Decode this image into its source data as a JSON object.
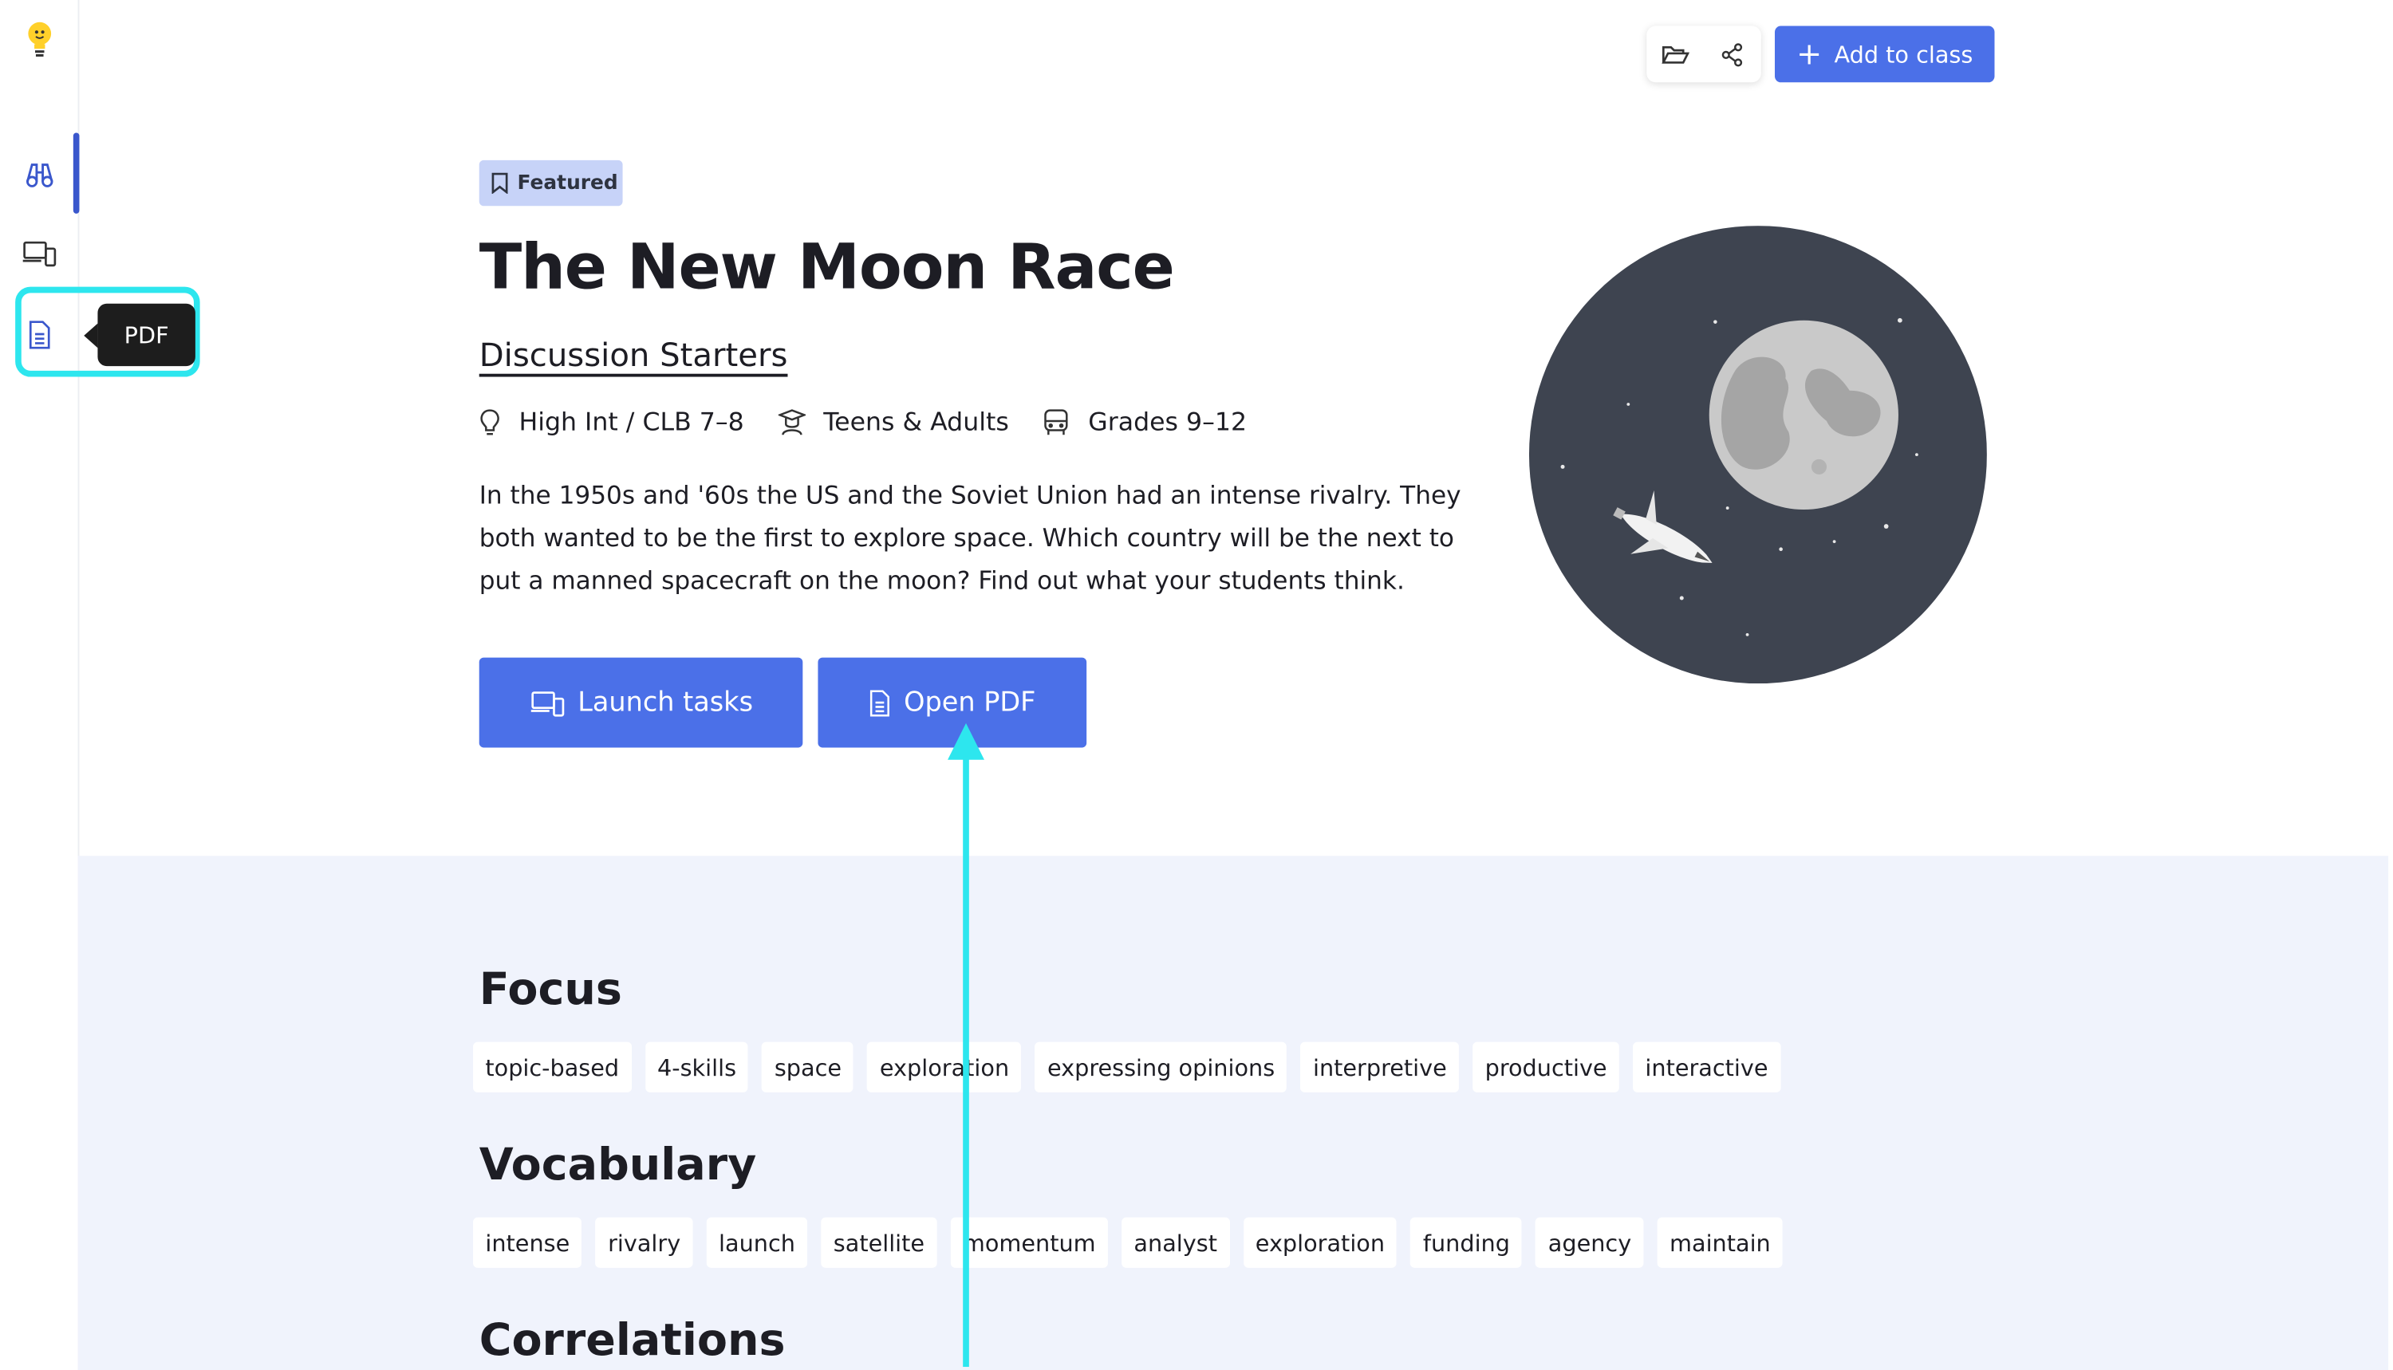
{
  "tooltip": {
    "label": "PDF"
  },
  "toolbar": {
    "add_label": "Add to class"
  },
  "hero": {
    "badge": "Featured",
    "title": "The New Moon Race",
    "subtitle": "Discussion Starters",
    "meta": {
      "level": "High Int / CLB 7–8",
      "audience": "Teens & Adults",
      "grades": "Grades 9–12"
    },
    "description": "In the 1950s and '60s the US and the Soviet Union had an intense rivalry. They both wanted to be the first to explore space. Which country will be the next to put a manned spacecraft on the moon? Find out what your students think.",
    "launch_label": "Launch tasks",
    "pdf_label": "Open PDF"
  },
  "focus": {
    "title": "Focus",
    "tags": [
      "topic-based",
      "4-skills",
      "space",
      "exploration",
      "expressing opinions",
      "interpretive",
      "productive",
      "interactive"
    ]
  },
  "vocabulary": {
    "title": "Vocabulary",
    "tags": [
      "intense",
      "rivalry",
      "launch",
      "satellite",
      "momentum",
      "analyst",
      "exploration",
      "funding",
      "agency",
      "maintain"
    ]
  },
  "correlations": {
    "title": "Correlations"
  },
  "colors": {
    "primary": "#4b70e8",
    "badge": "#c7d3f8",
    "section_bg": "#f0f3fc",
    "highlight": "#2de6ee",
    "moon_bg": "#3e4450"
  }
}
